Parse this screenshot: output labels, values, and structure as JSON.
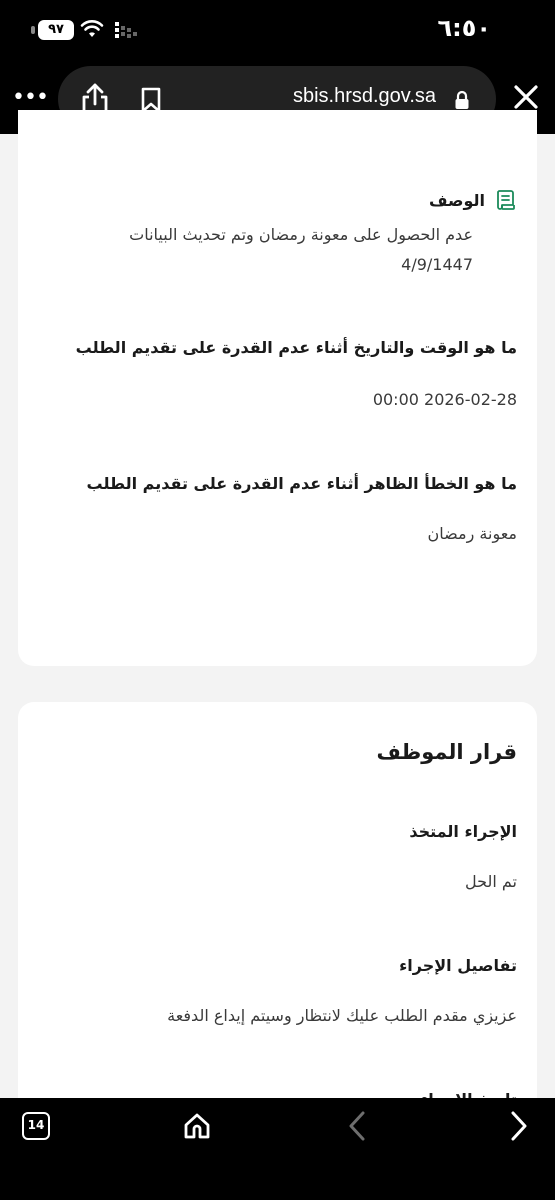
{
  "status_bar": {
    "time": "٦:٥٠",
    "battery": "٩٧"
  },
  "browser": {
    "url": "sbis.hrsd.gov.sa",
    "more_icon": "ellipsis-icon",
    "share_icon": "share-icon",
    "bookmark_icon": "bookmark-icon",
    "lock_icon": "lock-icon",
    "close_icon": "close-icon"
  },
  "request": {
    "description_label": "الوصف",
    "description_text": "عدم الحصول على معونة رمضان وتم تحديث البيانات 4/9/1447",
    "questions": [
      {
        "question": "ما هو الوقت والتاريخ أثناء عدم القدرة على تقديم الطلب",
        "answer": "2026-02-28 00:00"
      },
      {
        "question": "ما هو الخطأ الظاهر أثناء عدم القدرة على تقديم الطلب",
        "answer": "معونة رمضان"
      }
    ]
  },
  "decision": {
    "title": "قرار الموظف",
    "fields": [
      {
        "label": "الإجراء المتخذ",
        "value": "تم الحل"
      },
      {
        "label": "تفاصيل الإجراء",
        "value": "عزيزي مقدم الطلب عليك لانتظار وسيتم إيداع الدفعة"
      },
      {
        "label": "تاريخ الإجراء",
        "value": ""
      }
    ]
  },
  "bottom_bar": {
    "tab_count": "14",
    "home_icon": "home-icon",
    "back_icon": "chevron-left-icon",
    "forward_icon": "chevron-right-icon"
  },
  "colors": {
    "accent_green": "#1b8a5a",
    "page_bg": "#f3f3f3",
    "chrome_bg": "#000000"
  }
}
